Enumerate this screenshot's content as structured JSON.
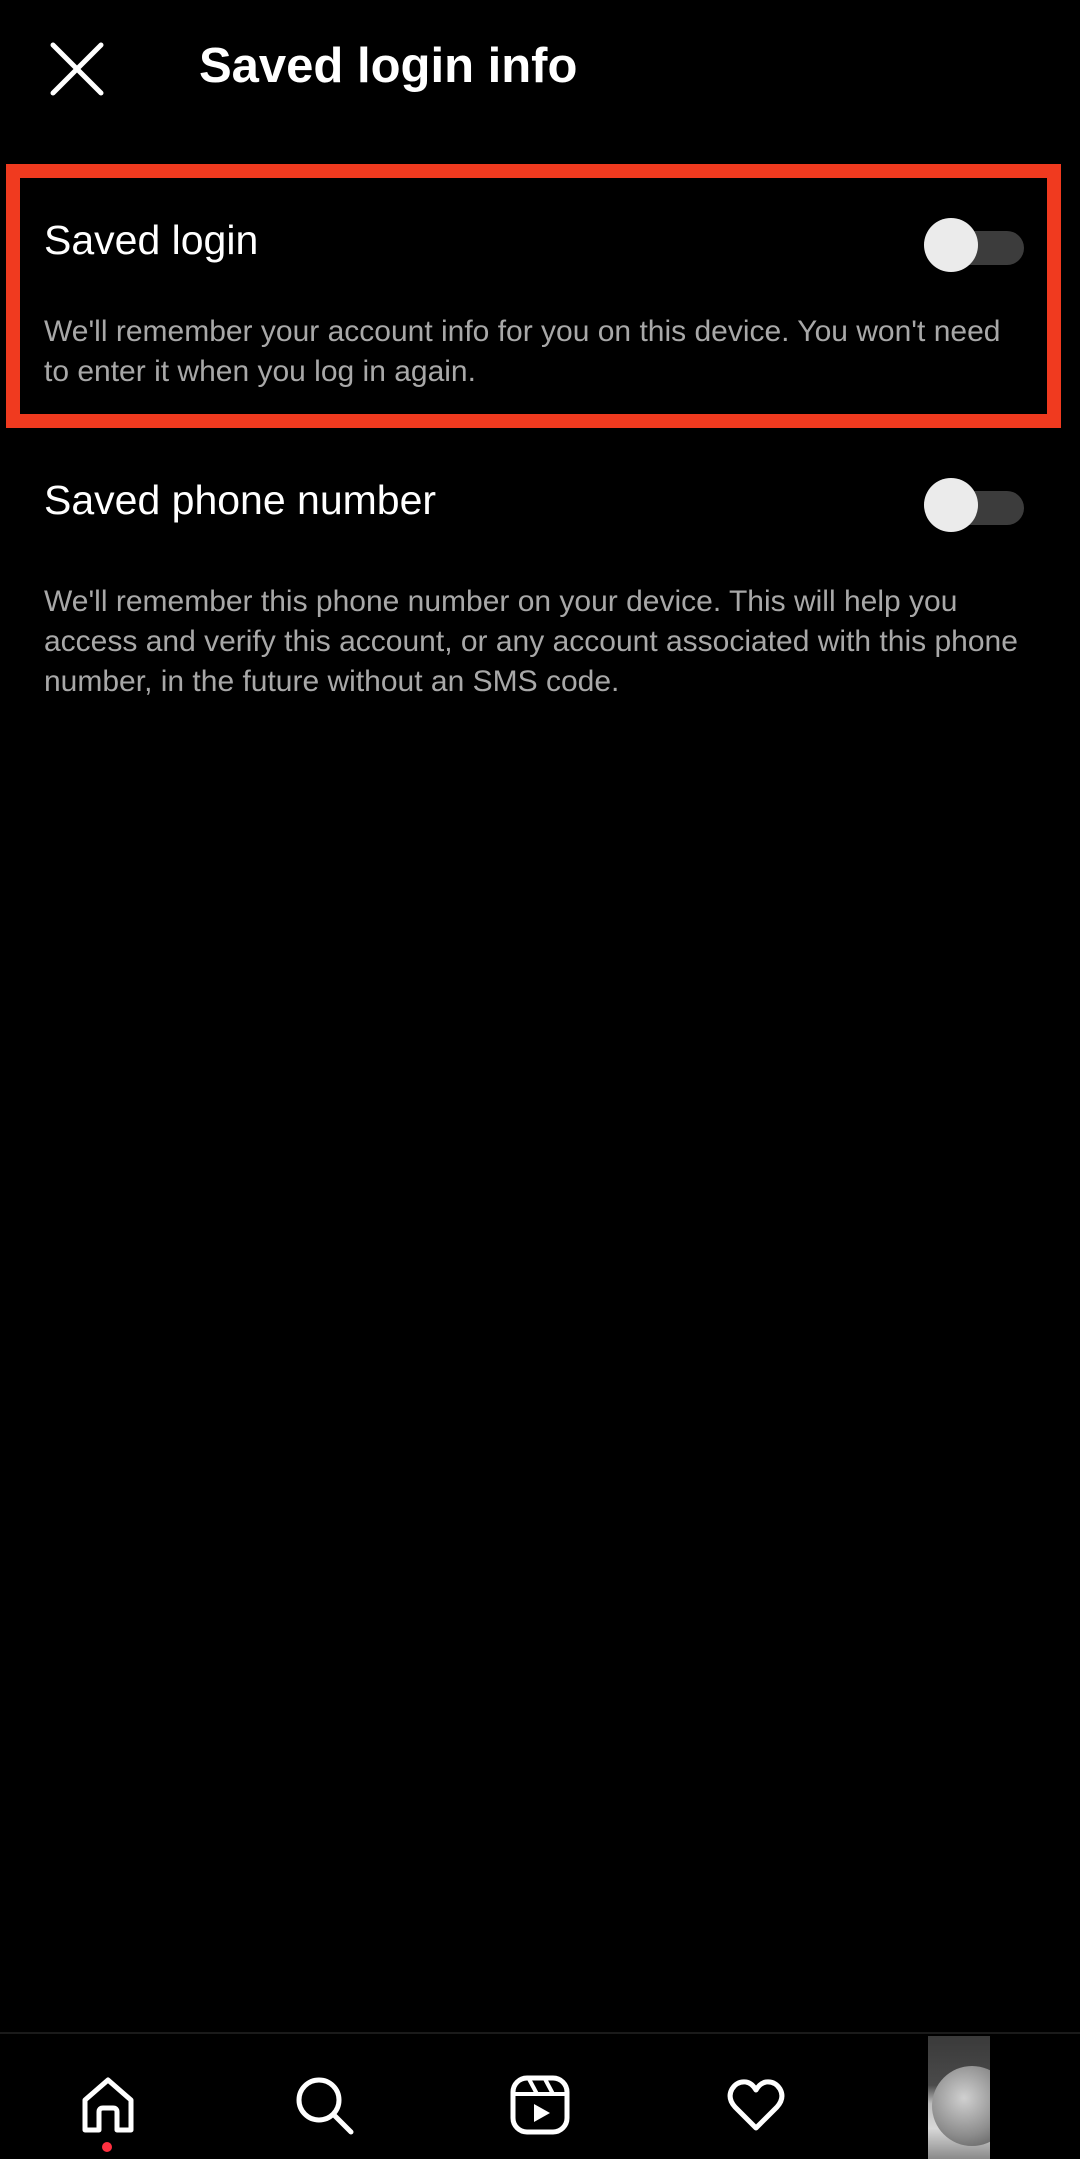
{
  "header": {
    "title": "Saved login info",
    "close_icon": "close-icon"
  },
  "settings": [
    {
      "title": "Saved login",
      "description": "We'll remember your account info for you on this device. You won't need to enter it when you log in again.",
      "enabled": false
    },
    {
      "title": "Saved phone number",
      "description": "We'll remember this phone number on your device. This will help you access and verify this account, or any account associated with this phone number, in the future without an SMS code.",
      "enabled": false
    }
  ],
  "highlight": {
    "color": "#f03a1f",
    "target": "Saved login"
  },
  "bottom_nav": {
    "items": [
      "home-icon",
      "search-icon",
      "reels-icon",
      "heart-icon",
      "profile-avatar"
    ],
    "notification_dot_color": "#ff3040"
  },
  "colors": {
    "background": "#000000",
    "text_primary": "#ffffff",
    "text_secondary": "#a8a8a8",
    "toggle_track_off": "#3c3c3c",
    "toggle_knob": "#ebebeb"
  }
}
